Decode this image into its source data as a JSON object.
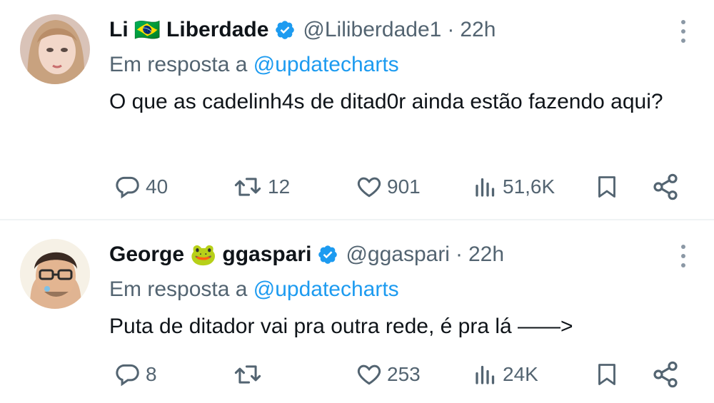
{
  "tweets": [
    {
      "name_part1": "Li",
      "flag": "🇧🇷",
      "name_part2": "Liberdade",
      "handle": "@Liliberdade1",
      "dot": "·",
      "time": "22h",
      "reply_prefix": "Em resposta a",
      "reply_mention": "@updatecharts",
      "text": "O que as cadelinh4s de ditad0r ainda estão fazendo aqui?",
      "replies": "40",
      "retweets": "12",
      "likes": "901",
      "views": "51,6K"
    },
    {
      "name_part1": "George",
      "flag": "🐸",
      "name_part2": "ggaspari",
      "handle": "@ggaspari",
      "dot": "·",
      "time": "22h",
      "reply_prefix": "Em resposta a",
      "reply_mention": "@updatecharts",
      "text": "Puta de ditador vai pra outra rede, é pra lá ——>",
      "replies": "8",
      "retweets": "",
      "likes": "253",
      "views": "24K"
    }
  ],
  "colors": {
    "verified": "#1d9bf0",
    "muted": "#536471",
    "link": "#1d9bf0"
  },
  "icons": [
    "reply-icon",
    "retweet-icon",
    "like-icon",
    "views-icon",
    "bookmark-icon",
    "share-icon",
    "verified-icon",
    "more-icon"
  ]
}
